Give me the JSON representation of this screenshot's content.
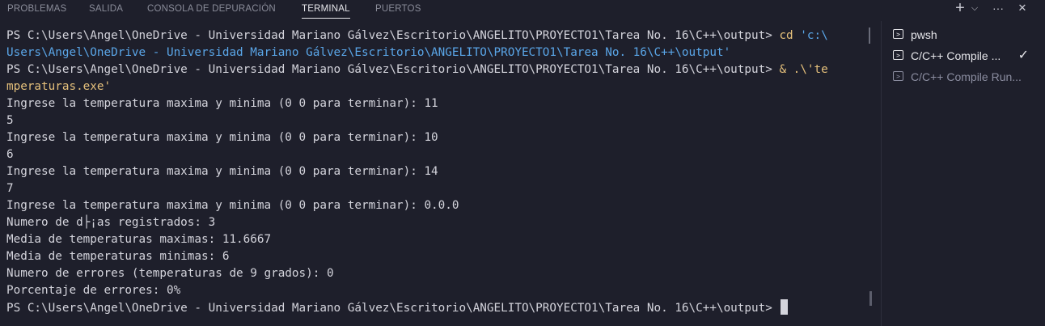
{
  "tabs": [
    "PROBLEMAS",
    "SALIDA",
    "CONSOLA DE DEPURACIÓN",
    "TERMINAL",
    "PUERTOS"
  ],
  "toolbar": {
    "add_icon": "+",
    "dropdown_icon": "⌵",
    "more_icon": "···",
    "close_icon": "✕"
  },
  "terminal": {
    "prompt1": "PS C:\\Users\\Angel\\OneDrive - Universidad Mariano Gálvez\\Escritorio\\ANGELITO\\PROYECTO1\\Tarea No. 16\\C++\\output> ",
    "cmd1": "cd",
    "arg1_part1": " 'c:\\",
    "arg1_part2": "Users\\Angel\\OneDrive - Universidad Mariano Gálvez\\Escritorio\\ANGELITO\\PROYECTO1\\Tarea No. 16\\C++\\output'",
    "prompt2": "PS C:\\Users\\Angel\\OneDrive - Universidad Mariano Gálvez\\Escritorio\\ANGELITO\\PROYECTO1\\Tarea No. 16\\C++\\output> ",
    "cmd2": "& .\\'te",
    "cmd2_cont": "mperaturas.exe'",
    "output": [
      "Ingrese la temperatura maxima y minima (0 0 para terminar): 11",
      "5",
      "Ingrese la temperatura maxima y minima (0 0 para terminar): 10",
      "6",
      "Ingrese la temperatura maxima y minima (0 0 para terminar): 14",
      "7",
      "Ingrese la temperatura maxima y minima (0 0 para terminar): 0.0.0",
      "Numero de d├¡as registrados: 3",
      "Media de temperaturas maximas: 11.6667",
      "Media de temperaturas minimas: 6",
      "Numero de errores (temperaturas de 9 grados): 0",
      "Porcentaje de errores: 0%"
    ],
    "prompt3": "PS C:\\Users\\Angel\\OneDrive - Universidad Mariano Gálvez\\Escritorio\\ANGELITO\\PROYECTO1\\Tarea No. 16\\C++\\output> "
  },
  "sidebar": {
    "items": [
      {
        "label": "pwsh"
      },
      {
        "label": "C/C++ Compile ..."
      },
      {
        "label": "C/C++ Compile Run..."
      }
    ]
  }
}
